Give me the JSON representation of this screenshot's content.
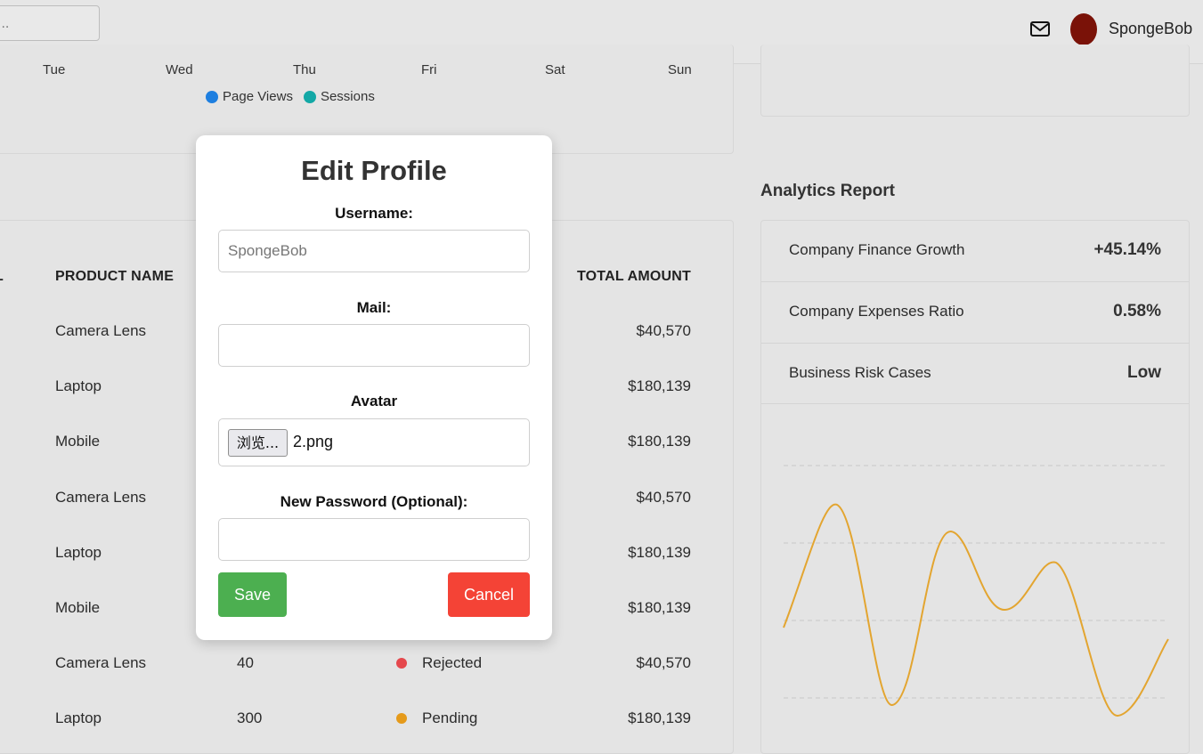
{
  "header": {
    "search_placeholder": "...",
    "mail_icon": "mail-icon",
    "user_name": "SpongeBob",
    "avatar_color": "#7a1208"
  },
  "chart_data": {
    "type": "line",
    "x": [
      "Tue",
      "Wed",
      "Thu",
      "Fri",
      "Sat",
      "Sun"
    ],
    "legend": [
      {
        "name": "Page Views",
        "color": "#1e7fe0"
      },
      {
        "name": "Sessions",
        "color": "#13a8a6"
      }
    ]
  },
  "orders_table": {
    "headers": [
      "PRODUCT NAME",
      "TOTAL AMOUNT"
    ],
    "rows": [
      {
        "product": "Camera Lens",
        "quantity": "",
        "status": "",
        "status_color": "",
        "amount": "$40,570"
      },
      {
        "product": "Laptop",
        "quantity": "",
        "status": "",
        "status_color": "",
        "amount": "$180,139"
      },
      {
        "product": "Mobile",
        "quantity": "",
        "status": "",
        "status_color": "",
        "amount": "$180,139"
      },
      {
        "product": "Camera Lens",
        "quantity": "",
        "status": "",
        "status_color": "",
        "amount": "$40,570"
      },
      {
        "product": "Laptop",
        "quantity": "",
        "status": "",
        "status_color": "",
        "amount": "$180,139"
      },
      {
        "product": "Mobile",
        "quantity": "",
        "status": "",
        "status_color": "",
        "amount": "$180,139"
      },
      {
        "product": "Camera Lens",
        "quantity": "40",
        "status": "Rejected",
        "status_color": "#e5484d",
        "amount": "$40,570"
      },
      {
        "product": "Laptop",
        "quantity": "300",
        "status": "Pending",
        "status_color": "#e59a1a",
        "amount": "$180,139"
      }
    ]
  },
  "analytics": {
    "title": "Analytics Report",
    "rows": [
      {
        "label": "Company Finance Growth",
        "value": "+45.14%"
      },
      {
        "label": "Company Expenses Ratio",
        "value": "0.58%"
      },
      {
        "label": "Business Risk Cases",
        "value": "Low"
      }
    ],
    "line_color": "#e3a530"
  },
  "modal": {
    "title": "Edit Profile",
    "username_label": "Username:",
    "username_placeholder": "SpongeBob",
    "mail_label": "Mail:",
    "mail_value": "",
    "avatar_label": "Avatar",
    "file_button_label": "浏览...",
    "file_name": "2.png",
    "password_label": "New Password (Optional):",
    "password_value": "",
    "save_label": "Save",
    "cancel_label": "Cancel",
    "save_color": "#4caf50",
    "cancel_color": "#f44336"
  }
}
